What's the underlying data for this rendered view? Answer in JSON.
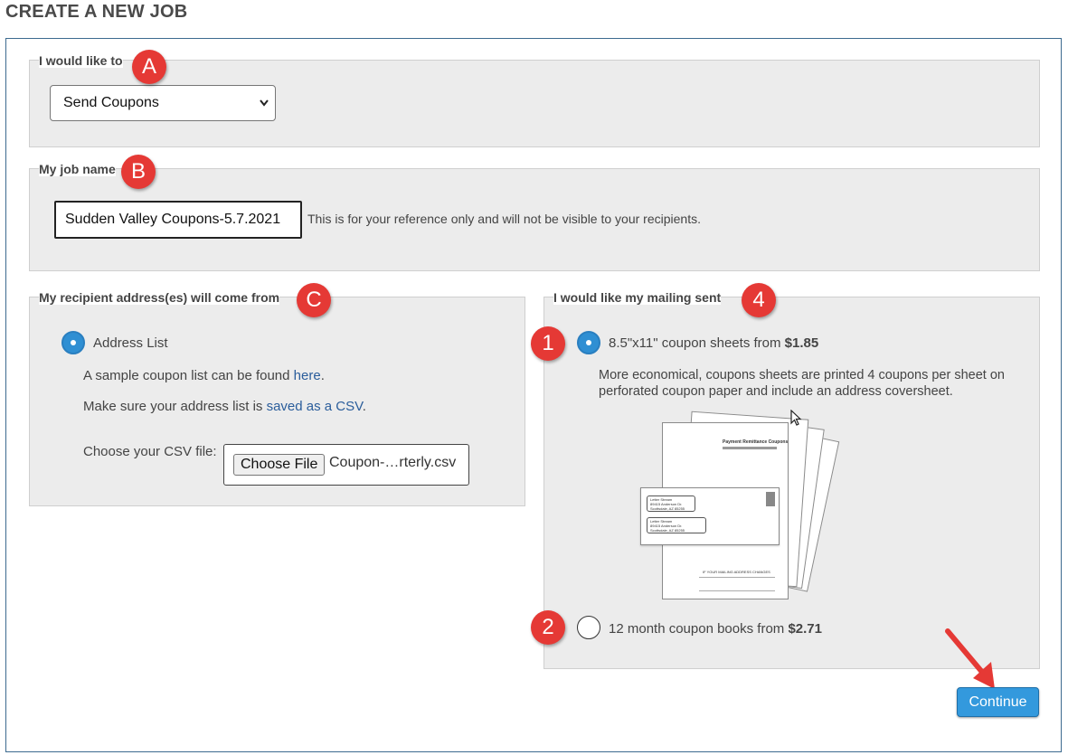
{
  "page": {
    "title": "CREATE A NEW JOB"
  },
  "section_a": {
    "legend": "I would like to",
    "badge": "A",
    "select_value": "Send Coupons",
    "chevron_icon": "chevron-down-icon"
  },
  "section_b": {
    "legend": "My job name",
    "badge": "B",
    "job_name_value": "Sudden Valley Coupons-5.7.2021",
    "note": "This is for your reference only and will not be visible to your recipients."
  },
  "section_c": {
    "legend": "My recipient address(es) will come from",
    "badge": "C",
    "option_label": "Address List",
    "sample_text": "A sample coupon list can be found ",
    "sample_link": "here",
    "sample_end": ".",
    "csv_text": "Make sure your address list is ",
    "csv_link": "saved as a CSV",
    "csv_end": ".",
    "file_label": "Choose your CSV file:",
    "file_button": "Choose File",
    "file_name": "Coupon-…rterly.csv"
  },
  "section_mail": {
    "legend": "I would like my mailing sent",
    "badge": "4",
    "option1": {
      "badge": "1",
      "label_prefix": "8.5\"x11\" coupon sheets from ",
      "price": "$1.85",
      "description_line1": "More economical, coupons sheets are printed 4 coupons per sheet on",
      "description_line2": "perforated coupon paper and include an address coversheet."
    },
    "option2": {
      "badge": "2",
      "label_prefix": "12 month coupon books from ",
      "price": "$2.71"
    },
    "preview": {
      "sheet_title": "Payment Remittance Coupons",
      "address_line1": "Letter Stream",
      "address_line2": "89415 Anderson Dr.",
      "address_line3": "Scottsdale, AZ 85255",
      "change_notice": "IF YOUR MAILING ADDRESS CHANGES"
    }
  },
  "actions": {
    "continue_label": "Continue"
  },
  "colors": {
    "badge": "#e53935",
    "radio": "#2f8fd3",
    "continue": "#3399dd",
    "link": "#2a5d9b",
    "arrow": "#e53935"
  }
}
